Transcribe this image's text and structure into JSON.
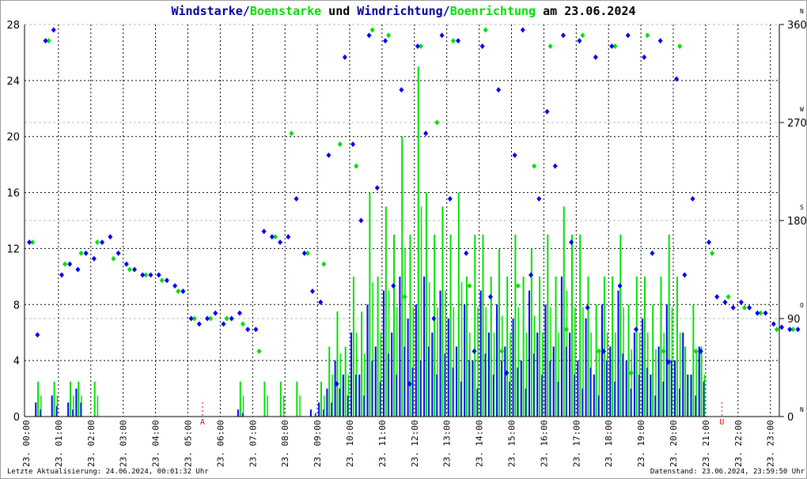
{
  "title": {
    "part1": "Windstarke",
    "sep1": "/",
    "part2": "Boenstarke",
    "mid": " und ",
    "part3": "Windrichtung",
    "sep2": "/",
    "part4": "Boenrichtung",
    "tail": " am 23.06.2024"
  },
  "footer": {
    "left": "Letzte Aktualisierung: 24.06.2024, 00:01:32 Uhr",
    "right": "Datenstand: 23.06.2024, 23:59:50 Uhr"
  },
  "colors": {
    "wind": "#0000ff",
    "gust": "#00e000",
    "marker": "#ff0000"
  },
  "chart_data": {
    "type": "bar+scatter",
    "title": "Windstarke/Boenstarke und Windrichtung/Boenrichtung am 23.06.2024",
    "ylim_left": [
      0,
      28
    ],
    "yticks_left": [
      "0",
      "4",
      "8",
      "12",
      "16",
      "20",
      "24",
      "28"
    ],
    "ylim_right": [
      0,
      360
    ],
    "yticks_right": [
      "0",
      "90",
      "180",
      "270",
      "360"
    ],
    "compass_labels": [
      "N",
      "O",
      "S",
      "W",
      "N"
    ],
    "xticks": [
      "23. 00:00",
      "23. 01:00",
      "23. 02:00",
      "23. 03:00",
      "23. 04:00",
      "23. 05:00",
      "23. 06:00",
      "23. 07:00",
      "23. 08:00",
      "23. 09:00",
      "23. 10:00",
      "23. 11:00",
      "23. 12:00",
      "23. 13:00",
      "23. 14:00",
      "23. 15:00",
      "23. 16:00",
      "23. 17:00",
      "23. 18:00",
      "23. 19:00",
      "23. 20:00",
      "23. 21:00",
      "23. 22:00",
      "23. 23:00"
    ],
    "annotations": [
      {
        "label": "A",
        "hour": 5.45
      },
      {
        "label": "U",
        "hour": 21.5
      }
    ],
    "wind_speed_15min": [
      0,
      1,
      0,
      1.5,
      0,
      1,
      2,
      0,
      0,
      0,
      0,
      0,
      0,
      0,
      0,
      0,
      0,
      0,
      0,
      0,
      0,
      0,
      0,
      0,
      0,
      0,
      0.5,
      0,
      0,
      0,
      0,
      0,
      0,
      0,
      0,
      0.5,
      1,
      2,
      4,
      3,
      6,
      3,
      8,
      5,
      9,
      6,
      10,
      7,
      8,
      10,
      6,
      9,
      7,
      5,
      8,
      4,
      9,
      6,
      8,
      5,
      7,
      4,
      9,
      6,
      8,
      5,
      10,
      6,
      4,
      7,
      3,
      8,
      5,
      9,
      4,
      6,
      7,
      3,
      5,
      8,
      4,
      6,
      3,
      5,
      0,
      0,
      0,
      0,
      0,
      0,
      0,
      0,
      0,
      0,
      0,
      0
    ],
    "gust_speed_15min": [
      0,
      2.5,
      0,
      2.5,
      0,
      2.5,
      2.5,
      0,
      2.5,
      0,
      0,
      0,
      0,
      0,
      0,
      0,
      0,
      0,
      0,
      0,
      0,
      0,
      0,
      0,
      0,
      0,
      2.5,
      0,
      0,
      2.5,
      0,
      2.5,
      0,
      2.5,
      0,
      0,
      2.5,
      5,
      7.5,
      5,
      10,
      7.5,
      16,
      10,
      15,
      13,
      20,
      13,
      25,
      16,
      13,
      15,
      13,
      16,
      10,
      13,
      13,
      10,
      12,
      10,
      13,
      10,
      12,
      10,
      13,
      10,
      15,
      13,
      13,
      10,
      8,
      10,
      10,
      13,
      8,
      10,
      10,
      8,
      10,
      13,
      10,
      5,
      8,
      5,
      0,
      0,
      0,
      0,
      0,
      0,
      0,
      0,
      0,
      0,
      0,
      0
    ],
    "wind_direction_15min": [
      160,
      75,
      345,
      355,
      130,
      140,
      135,
      150,
      145,
      160,
      165,
      150,
      140,
      135,
      130,
      130,
      130,
      125,
      120,
      115,
      90,
      85,
      90,
      95,
      85,
      90,
      95,
      80,
      80,
      170,
      165,
      160,
      165,
      200,
      150,
      115,
      105,
      240,
      30,
      330,
      250,
      180,
      350,
      210,
      345,
      120,
      300,
      30,
      340,
      260,
      90,
      350,
      200,
      345,
      150,
      60,
      340,
      110,
      300,
      40,
      240,
      355,
      130,
      200,
      280,
      230,
      350,
      160,
      345,
      100,
      330,
      60,
      340,
      120,
      350,
      80,
      330,
      150,
      345,
      50,
      310,
      130,
      200,
      60,
      160,
      110,
      105,
      100,
      105,
      100,
      95,
      95,
      85,
      82,
      80,
      80
    ],
    "gust_direction_30min": [
      160,
      345,
      140,
      150,
      160,
      145,
      135,
      130,
      125,
      115,
      90,
      90,
      90,
      85,
      60,
      165,
      260,
      150,
      140,
      250,
      230,
      355,
      350,
      110,
      340,
      270,
      345,
      120,
      355,
      60,
      120,
      230,
      340,
      80,
      350,
      60,
      340,
      40,
      350,
      60,
      340,
      60,
      150,
      110,
      100,
      95,
      80,
      80
    ]
  }
}
